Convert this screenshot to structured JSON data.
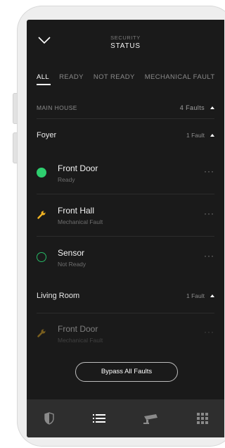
{
  "header": {
    "subtitle": "SECURITY",
    "title": "STATUS"
  },
  "tabs": [
    {
      "label": "ALL",
      "active": true
    },
    {
      "label": "READY",
      "active": false
    },
    {
      "label": "NOT READY",
      "active": false
    },
    {
      "label": "MECHANICAL FAULT",
      "active": false
    }
  ],
  "group": {
    "label": "MAIN HOUSE",
    "count": "4 Faults"
  },
  "rooms": [
    {
      "name": "Foyer",
      "count": "1 Fault"
    },
    {
      "name": "Living Room",
      "count": "1 Fault"
    }
  ],
  "devices": [
    {
      "name": "Front Door",
      "status": "Ready",
      "icon": "ready-dot-icon",
      "more": "···"
    },
    {
      "name": "Front Hall",
      "status": "Mechanical Fault",
      "icon": "wrench-icon",
      "more": "···"
    },
    {
      "name": "Sensor",
      "status": "Not Ready",
      "icon": "not-ready-ring-icon",
      "more": "···"
    },
    {
      "name": "Front Door",
      "status": "Mechanical Fault",
      "icon": "wrench-icon",
      "more": "···"
    }
  ],
  "bypass_label": "Bypass All Faults",
  "nav": [
    "shield-icon",
    "list-icon",
    "camera-icon",
    "grid-icon"
  ],
  "colors": {
    "ready": "#2ecf6f",
    "fault": "#f0b323",
    "background": "#1a1a1a",
    "nav": "#2e2e2e"
  }
}
